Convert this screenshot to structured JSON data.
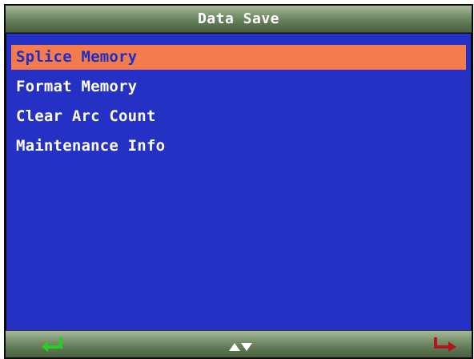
{
  "window": {
    "title": "Data Save"
  },
  "menu": {
    "items": [
      {
        "label": "Splice Memory",
        "selected": true
      },
      {
        "label": "Format Memory",
        "selected": false
      },
      {
        "label": "Clear Arc Count",
        "selected": false
      },
      {
        "label": "Maintenance Info",
        "selected": false
      }
    ]
  },
  "footer": {
    "icons": [
      "enter-return-icon",
      "up-down-arrows-icon",
      "back-exit-icon"
    ]
  },
  "colors": {
    "background": "#2531c4",
    "selection": "#f47c4c",
    "selection_text": "#1f2ec7",
    "text": "#ffffff",
    "bar_green": "#6b8560",
    "enter_icon": "#24d11f",
    "exit_icon": "#b0161c"
  }
}
